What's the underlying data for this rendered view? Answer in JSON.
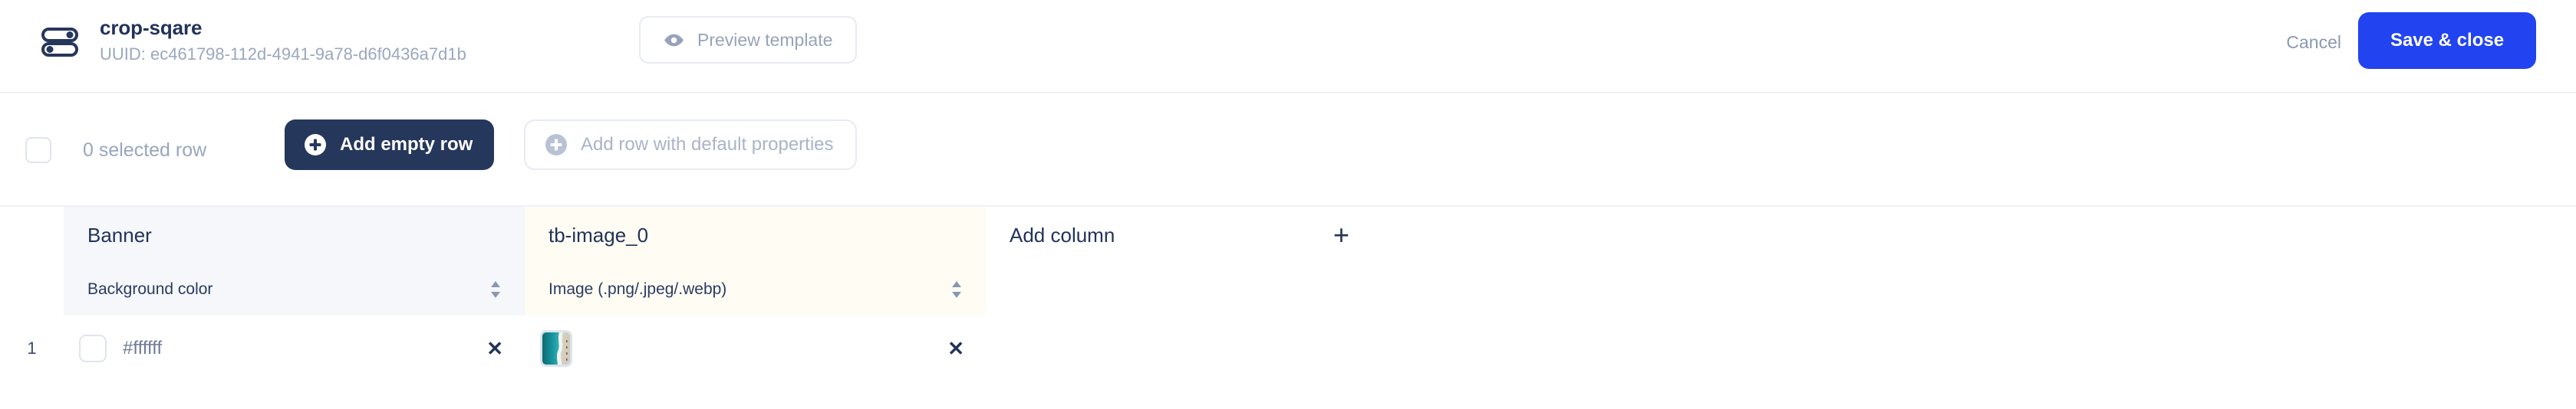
{
  "header": {
    "icon": "toggle-switch-icon",
    "title": "crop-sqare",
    "uuid_label": "UUID: ec461798-112d-4941-9a78-d6f0436a7d1b",
    "preview_button": {
      "label": "Preview template",
      "icon": "eye-icon"
    },
    "cancel_label": "Cancel",
    "save_label": "Save & close",
    "accent_color": "#2243f0",
    "title_color": "#22335a",
    "muted_color": "#9ba7bf"
  },
  "toolbar": {
    "select_all_checked": false,
    "selected_text": "0 selected row",
    "add_empty_row": {
      "label": "Add empty row",
      "icon": "plus-circle-icon",
      "background": "#26375c"
    },
    "add_default_row": {
      "label": "Add row with default properties",
      "icon": "plus-circle-icon",
      "disabled": true
    }
  },
  "table": {
    "row_number_header": "",
    "columns": [
      {
        "name": "Banner",
        "type_label": "Background color",
        "header_background": "#f5f7fb",
        "sort_icon": "chevron-updown-icon"
      },
      {
        "name": "tb-image_0",
        "type_label": "Image (.png/.jpeg/.webp)",
        "header_background": "#fffcf4",
        "sort_icon": "chevron-updown-icon"
      }
    ],
    "add_column": {
      "label": "Add column",
      "icon": "plus-icon"
    },
    "rows": [
      {
        "number": "1",
        "cells": [
          {
            "kind": "color",
            "swatch_color": "#ffffff",
            "value": "#ffffff",
            "clear_icon": "close-icon"
          },
          {
            "kind": "image",
            "thumbnail_alt": "aerial-beach-photo",
            "value": "",
            "clear_icon": "close-icon"
          },
          {
            "kind": "empty",
            "value": ""
          }
        ]
      }
    ]
  }
}
